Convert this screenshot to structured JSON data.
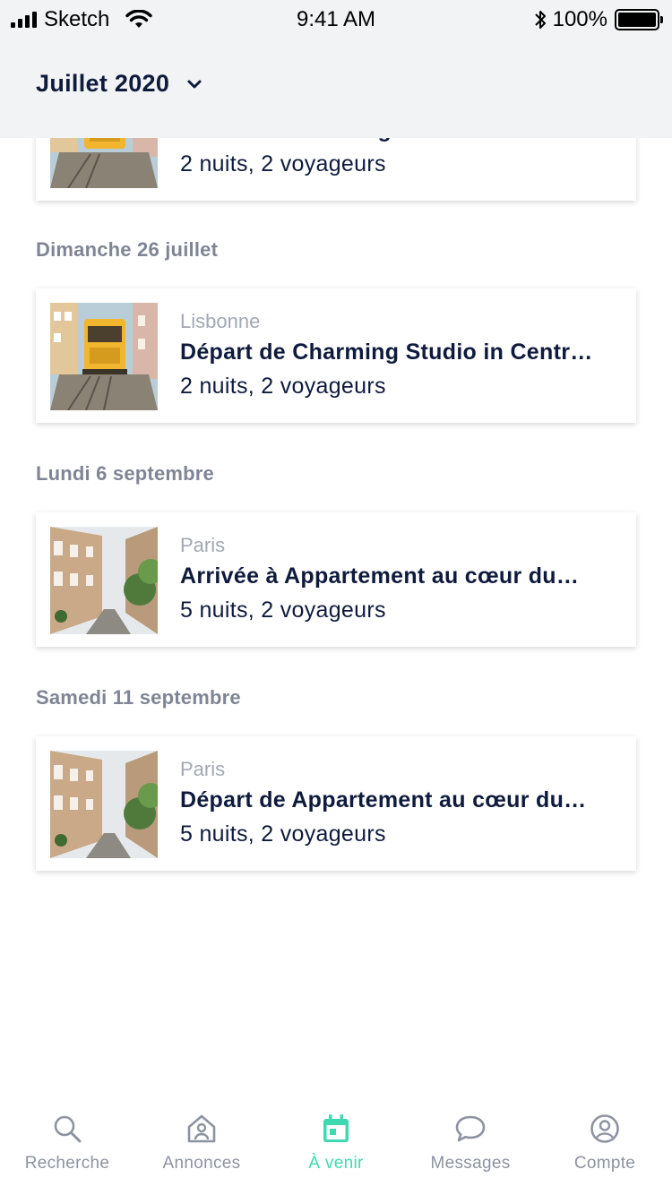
{
  "status_bar": {
    "carrier": "Sketch",
    "time": "9:41 AM",
    "battery": "100%"
  },
  "header": {
    "month": "Juillet 2020"
  },
  "days": [
    {
      "date": "",
      "card": {
        "city": "",
        "title": "Arrivée à Charming Studio in Centr…",
        "details": "2 nuits, 2 voyageurs",
        "image": "lisbon-tram"
      }
    },
    {
      "date": "Dimanche 26 juillet",
      "card": {
        "city": "Lisbonne",
        "title": "Départ de Charming Studio in Centr…",
        "details": "2 nuits, 2 voyageurs",
        "image": "lisbon-tram"
      }
    },
    {
      "date": "Lundi 6 septembre",
      "card": {
        "city": "Paris",
        "title": "Arrivée à Appartement au cœur du…",
        "details": "5 nuits, 2 voyageurs",
        "image": "paris-street"
      }
    },
    {
      "date": "Samedi 11 septembre",
      "card": {
        "city": "Paris",
        "title": "Départ de Appartement au cœur du…",
        "details": "5 nuits, 2 voyageurs",
        "image": "paris-street"
      }
    }
  ],
  "tabbar": {
    "tabs": [
      {
        "label": "Recherche",
        "icon": "search-icon",
        "active": false
      },
      {
        "label": "Annonces",
        "icon": "house-icon",
        "active": false
      },
      {
        "label": "À venir",
        "icon": "calendar-icon",
        "active": true
      },
      {
        "label": "Messages",
        "icon": "chat-bubble-icon",
        "active": false
      },
      {
        "label": "Compte",
        "icon": "account-icon",
        "active": false
      }
    ]
  },
  "colors": {
    "accent": "#3fd9b0",
    "navy": "#0f1b3d",
    "muted": "#7f8594",
    "header_bg": "#f2f3f4"
  }
}
